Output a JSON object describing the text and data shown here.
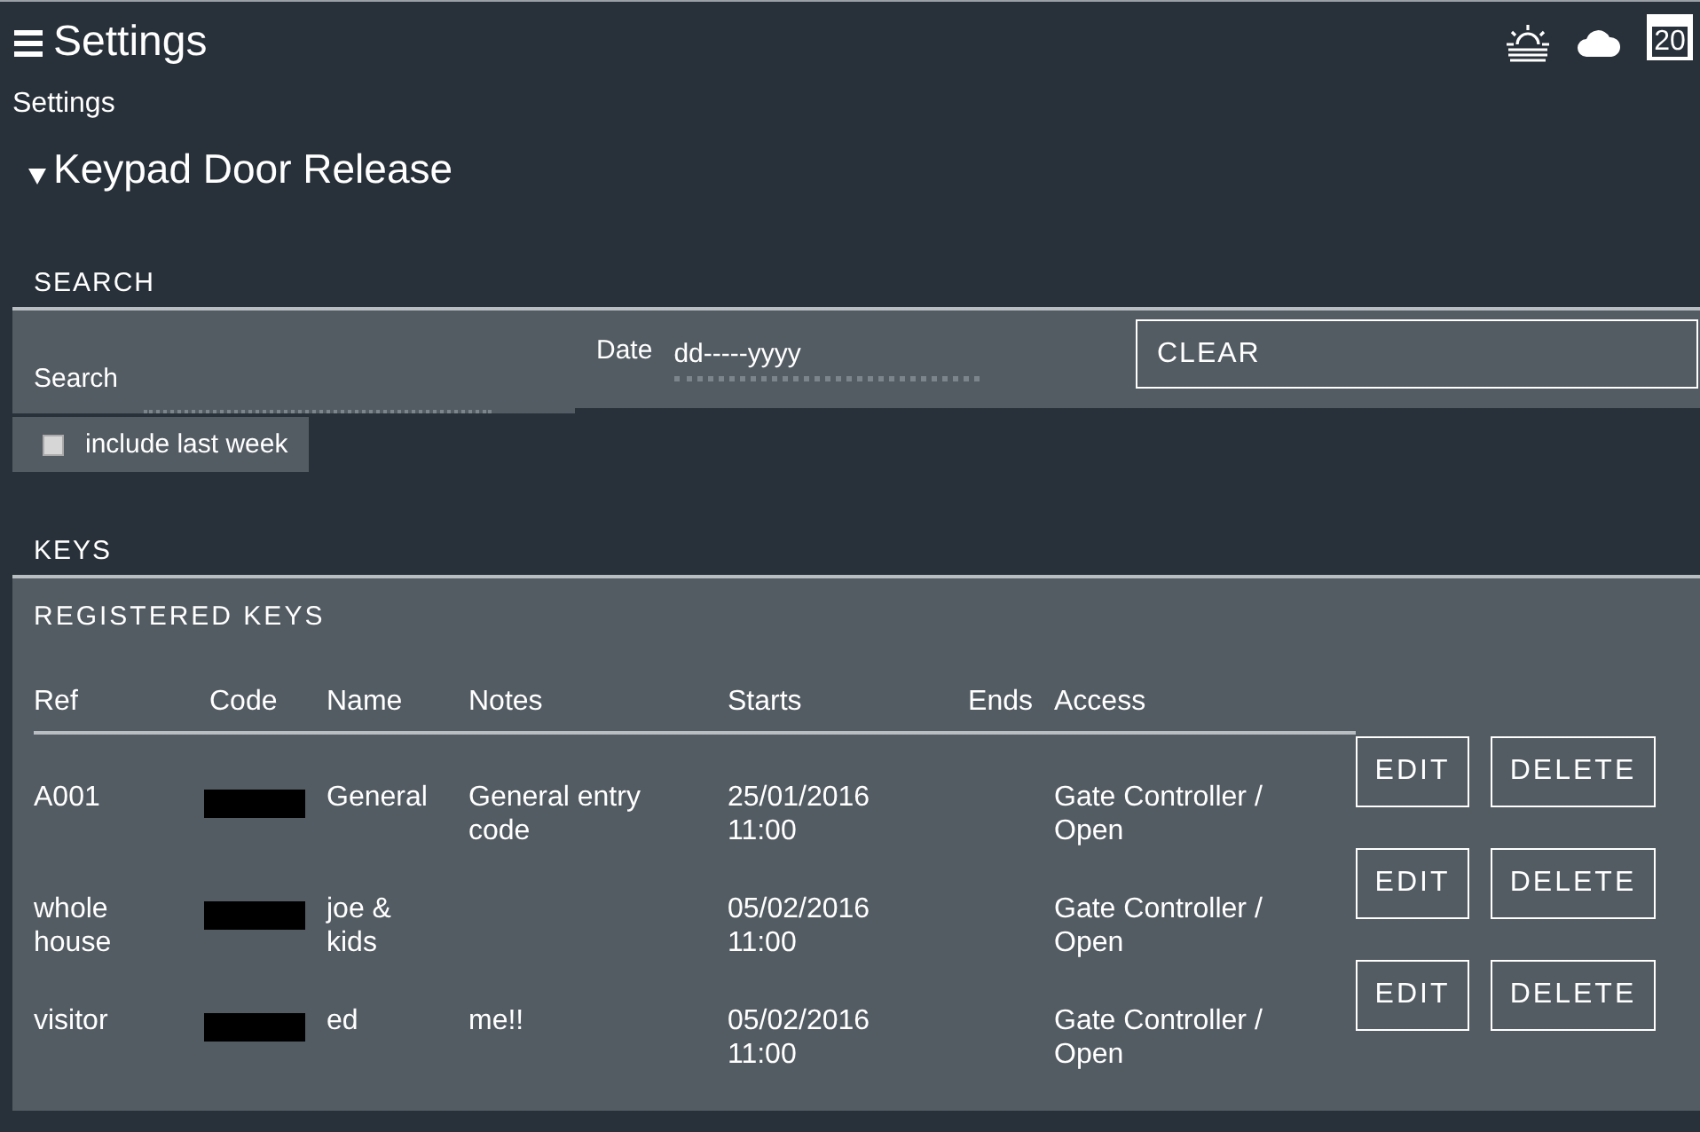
{
  "header": {
    "title": "Settings",
    "calendar_day": "20"
  },
  "breadcrumb": "Settings",
  "section": {
    "title": "Keypad Door Release",
    "expanded": true
  },
  "search": {
    "heading": "SEARCH",
    "search_label": "Search",
    "date_label": "Date",
    "date_value": "dd-----yyyy",
    "clear_button": "CLEAR",
    "include_last_week": {
      "label": "include last week",
      "checked": false
    }
  },
  "keys": {
    "heading": "KEYS",
    "subheading": "REGISTERED KEYS",
    "columns": [
      "Ref",
      "Code",
      "Name",
      "Notes",
      "Starts",
      "Ends",
      "Access"
    ],
    "rows": [
      {
        "ref": "A001",
        "name": "General",
        "notes": "General entry code",
        "starts": "25/01/2016 11:00",
        "access": "Gate Controller / Open",
        "actions": [
          "EDIT",
          "DELETE"
        ]
      },
      {
        "ref": "whole house",
        "name": "joe & kids",
        "starts": "05/02/2016 11:00",
        "access": "Gate Controller / Open",
        "actions": [
          "EDIT",
          "DELETE"
        ]
      },
      {
        "ref": "visitor",
        "name": "ed",
        "notes": "me!!",
        "starts": "05/02/2016 11:00",
        "access": "Gate Controller / Open",
        "actions": [
          "EDIT",
          "DELETE"
        ]
      }
    ]
  }
}
